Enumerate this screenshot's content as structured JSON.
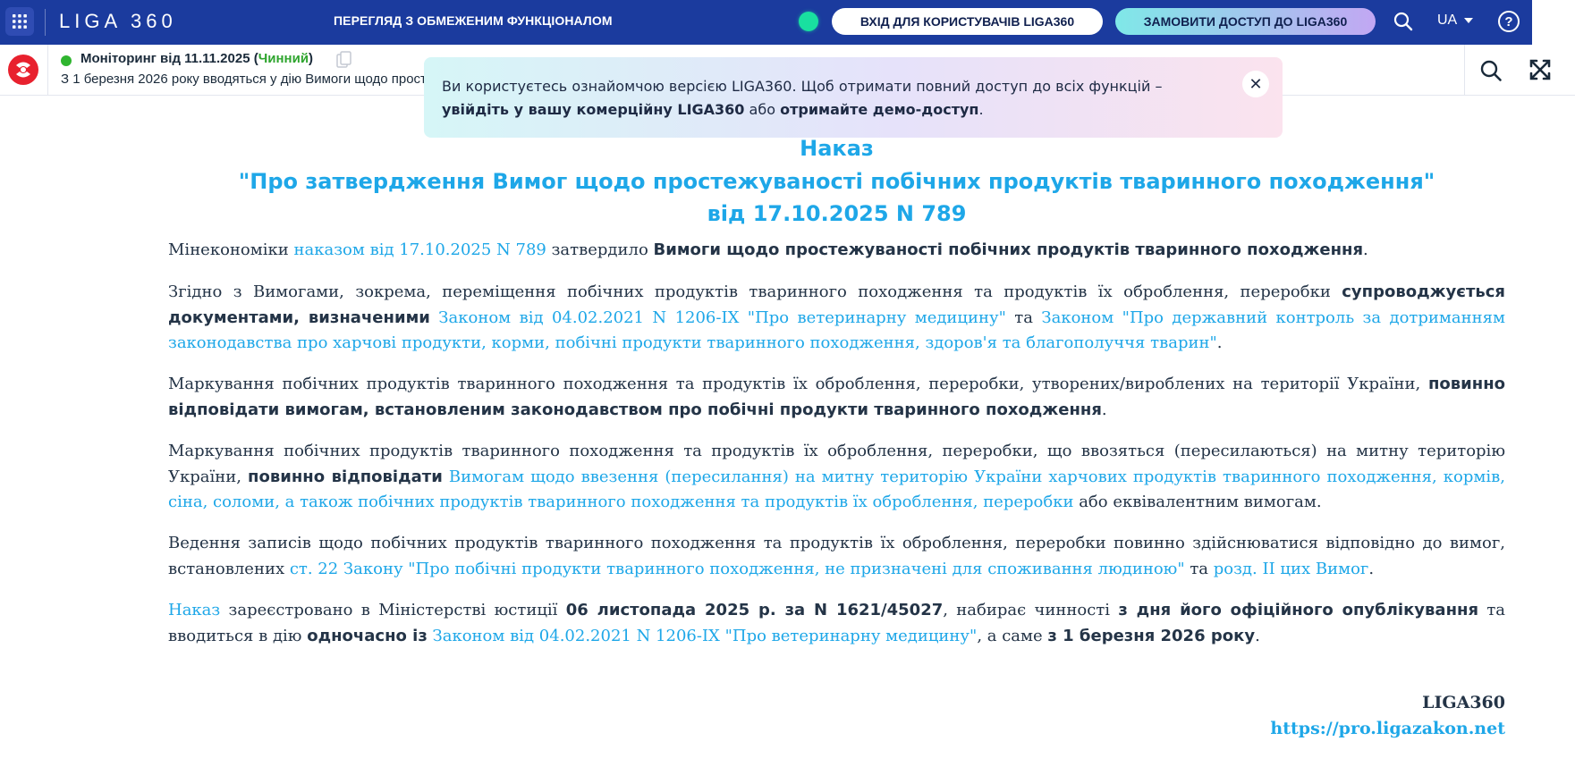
{
  "topbar": {
    "brand": "LIGA 360",
    "restricted_label": "ПЕРЕГЛЯД З ОБМЕЖЕНИМ ФУНКЦІОНАЛОМ",
    "login_button": "ВХІД ДЛЯ КОРИСТУВАЧІВ LIGA360",
    "order_button": "ЗАМОВИТИ ДОСТУП ДО LIGA360",
    "language": "UA",
    "help_symbol": "?",
    "colors": {
      "background": "#1b3b9e",
      "status_dot": "#19e0a0"
    }
  },
  "subbar": {
    "title_prefix": "Моніторинг від 11.11.2025 (",
    "status": "Чинний",
    "title_suffix": ")",
    "ticker": "З 1 березня 2026 року вводяться у дію Вимоги щодо простежуваності побічних продуктів",
    "icons": [
      "liga-logo-icon",
      "copy-icon",
      "search-icon",
      "expand-icon"
    ]
  },
  "notice": {
    "text_start": "Ви користуєтесь ознайомчою версією LIGA360. Щоб отримати повний доступ до всіх функцій –",
    "login_link": "увійдіть у вашу комерційну LIGA360",
    "or": "або",
    "demo_link": "отримайте демо-доступ",
    "end": ".",
    "close_symbol": "✕"
  },
  "document": {
    "heading_line1": "Наказ",
    "heading_line2": "\"Про затвердження Вимог щодо простежуваності побічних продуктів тваринного походження\"",
    "heading_line3": "від 17.10.2025 N 789",
    "p1": {
      "t1": "Мінекономіки ",
      "link1": "наказом від 17.10.2025 N 789",
      "t2": " затвердило ",
      "b1": "Вимоги щодо простежуваності побічних продуктів тваринного походження",
      "t3": "."
    },
    "p2": {
      "t1": "Згідно з Вимогами, зокрема, переміщення побічних продуктів тваринного походження та продуктів їх оброблення, переробки ",
      "b1": "супроводжується документами, визначеними",
      "t2": " ",
      "link1": "Законом від 04.02.2021 N 1206-IX \"Про ветеринарну медицину\"",
      "t3": " та ",
      "link2": "Законом \"Про державний контроль за дотриманням законодавства про харчові продукти, корми, побічні продукти тваринного походження, здоров'я та благополуччя тварин\"",
      "t4": "."
    },
    "p3": {
      "t1": "Маркування побічних продуктів тваринного походження та продуктів їх оброблення, переробки, утворених/вироблених на території України, ",
      "b1": "повинно відповідати вимогам, встановленим законодавством про побічні продукти тваринного походження",
      "t2": "."
    },
    "p4": {
      "t1": "Маркування побічних продуктів тваринного походження та продуктів їх оброблення, переробки, що ввозяться (пересилаються) на митну територію України, ",
      "b1": "повинно відповідати",
      "t2": " ",
      "link1": "Вимогам щодо ввезення (пересилання) на митну територію України харчових продуктів тваринного походження, кормів, сіна, соломи, а також побічних продуктів тваринного походження та продуктів їх оброблення, переробки",
      "t3": " або еквівалентним вимогам."
    },
    "p5": {
      "t1": "Ведення записів щодо побічних продуктів тваринного походження та продуктів їх оброблення, переробки повинно здійснюватися відповідно до вимог, встановлених ",
      "link1": "ст. 22 Закону \"Про побічні продукти тваринного походження, не призначені для споживання людиною\"",
      "t2": " та ",
      "link2": "розд. II цих Вимог",
      "t3": "."
    },
    "p6": {
      "link1": "Наказ",
      "t1": " зареєстровано в Міністерстві юстиції ",
      "b1": "06 листопада 2025 р. за N 1621/45027",
      "t2": ", набирає чинності ",
      "b2": "з дня його офіційного опублікування",
      "t3": " та вводиться в дію ",
      "b3": "одночасно із",
      "t4": " ",
      "link2": "Законом від 04.02.2021 N 1206-IX \"Про ветеринарну медицину\"",
      "t5": ", а саме ",
      "b4": "з 1 березня 2026 року",
      "t6": "."
    },
    "signature": "LIGA360",
    "signature_link": "https://pro.ligazakon.net",
    "colors": {
      "link": "#1ea7e8",
      "text": "#243447",
      "valid": "#2fa52f"
    }
  }
}
